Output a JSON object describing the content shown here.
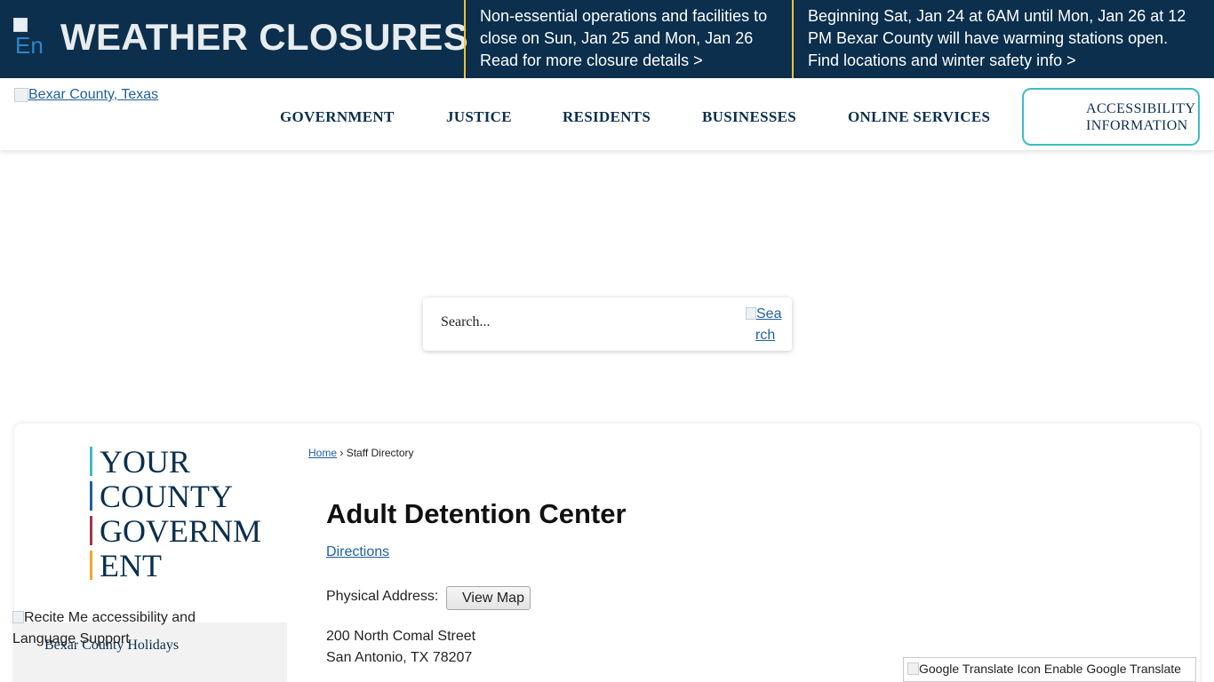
{
  "alert": {
    "title": "WEATHER CLOSURES",
    "icon_alt": "En",
    "icon": "broken-image-icon",
    "messages": [
      {
        "line1": "Non-essential operations and facilities to",
        "line2": "close on Sun, Jan 25 and Mon, Jan 26",
        "line3": "Read for more closure details >"
      },
      {
        "line1": "Beginning Sat, Jan 24 at 6AM until Mon, Jan 26 at 12",
        "line2": "PM Bexar County will have warming stations open.",
        "line3": "Find locations and winter safety info >"
      }
    ],
    "separator_color": "#f2c230",
    "background_color": "#0b2f4d"
  },
  "header": {
    "logo_alt": "Bexar County, Texas",
    "nav": [
      "GOVERNMENT",
      "JUSTICE",
      "RESIDENTS",
      "BUSINESSES",
      "ONLINE SERVICES"
    ],
    "accessibility": {
      "line1": "ACCESSIBILITY",
      "line2": "INFORMATION"
    },
    "accent_color": "#3ebcc3"
  },
  "search": {
    "placeholder": "Search...",
    "button_alt_1": "Sea",
    "button_alt_2": "rch"
  },
  "sidebar": {
    "title_lines": [
      {
        "text": "YOUR",
        "color": "#3ebcc3"
      },
      {
        "text": "COUNTY",
        "color": "#1f5f9e"
      },
      {
        "text": "GOVERNM",
        "color": "#a3344f"
      },
      {
        "text": "ENT",
        "color": "#f0a72a"
      }
    ],
    "recite_alt": "Recite Me accessibility and Language Support",
    "holidays_link": "Bexar County Holidays"
  },
  "main": {
    "breadcrumb": {
      "home": "Home",
      "separator": "›",
      "current": "Staff Directory"
    },
    "title": "Adult Detention Center",
    "directions": "Directions",
    "physical_address_label": "Physical Address:",
    "view_map": "View Map",
    "address_line1": "200 North Comal Street",
    "address_line2": "San Antonio, TX 78207"
  },
  "translate": {
    "label": "Google Translate Icon Enable Google Translate"
  }
}
